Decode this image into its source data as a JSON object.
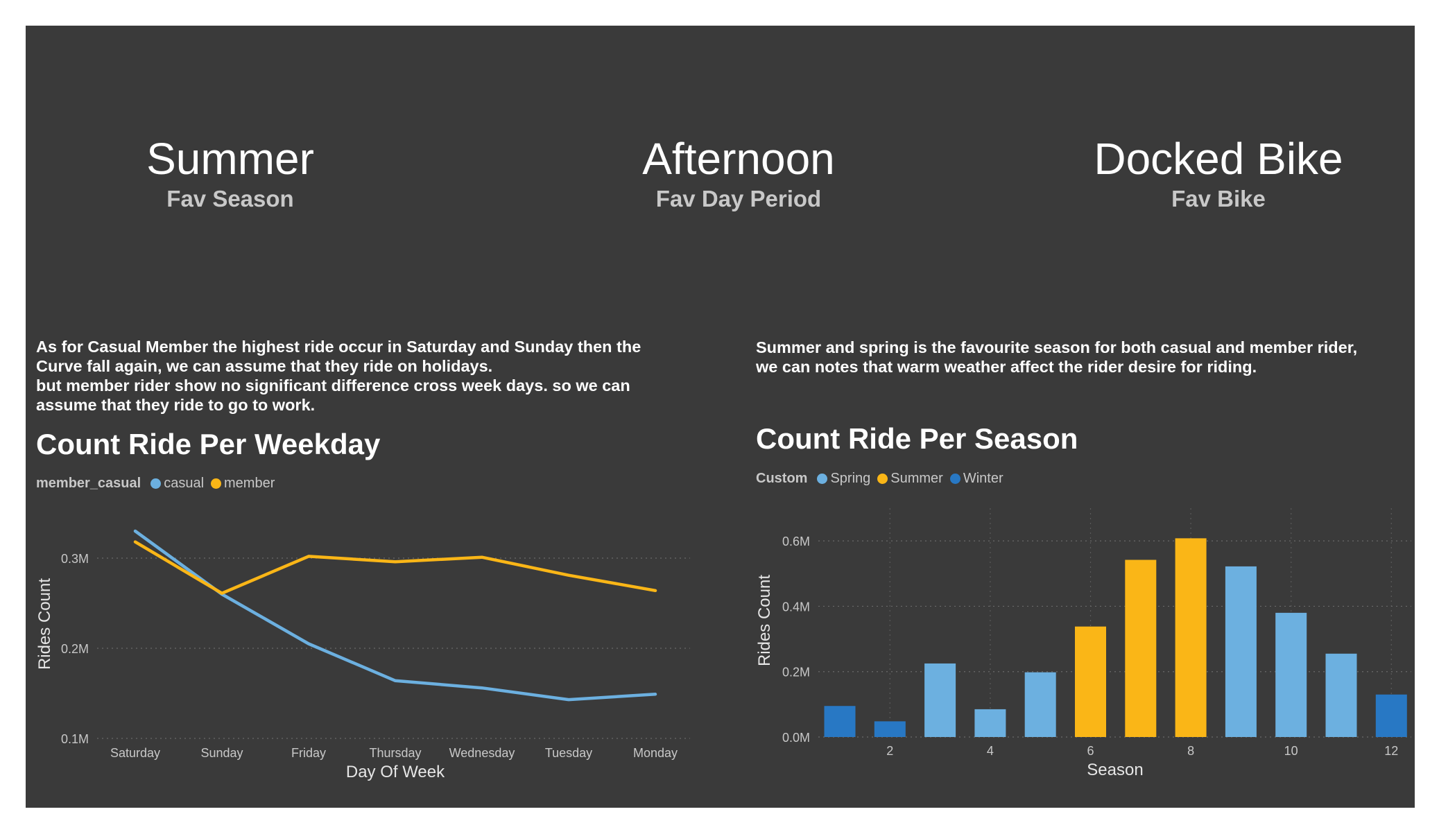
{
  "kpis": [
    {
      "value": "Summer",
      "label": "Fav Season"
    },
    {
      "value": "Afternoon",
      "label": "Fav Day Period"
    },
    {
      "value": "Docked Bike",
      "label": "Fav Bike"
    }
  ],
  "notes": {
    "weekday": [
      "As for Casual Member the highest ride occur in Saturday and Sunday then the",
      "Curve fall again, we can assume that they ride on holidays.",
      "but member rider show no significant difference cross week days. so we can",
      "assume that they ride to go to work."
    ],
    "season": [
      "Summer and spring is the favourite season for both casual and member rider,",
      "we can notes that warm weather affect the rider desire for riding."
    ]
  },
  "colors": {
    "background": "#3a3a3a",
    "casual": "#6cb0e0",
    "member": "#fab617",
    "spring": "#6cb0e0",
    "summer": "#fab617",
    "winter": "#2878c4"
  },
  "chart_data": [
    {
      "type": "line",
      "title": "Count Ride Per Weekday",
      "legend_title": "member_casual",
      "categories": [
        "Saturday",
        "Sunday",
        "Friday",
        "Thursday",
        "Wednesday",
        "Tuesday",
        "Monday"
      ],
      "series": [
        {
          "name": "casual",
          "values": [
            0.33,
            0.26,
            0.205,
            0.164,
            0.156,
            0.143,
            0.149
          ]
        },
        {
          "name": "member",
          "values": [
            0.318,
            0.261,
            0.302,
            0.296,
            0.301,
            0.281,
            0.264
          ]
        }
      ],
      "xlabel": "Day Of Week",
      "ylabel": "Rides Count",
      "yticks": [
        0.1,
        0.2,
        0.3
      ],
      "ytick_labels": [
        "0.1M",
        "0.2M",
        "0.3M"
      ],
      "ylim": [
        0.1,
        0.35
      ],
      "unit": "M",
      "grid": true,
      "legend_position": "top-left"
    },
    {
      "type": "bar",
      "title": "Count Ride Per Season",
      "legend_title": "Custom",
      "legend": [
        "Spring",
        "Summer",
        "Winter"
      ],
      "x": [
        1,
        2,
        3,
        4,
        5,
        6,
        7,
        8,
        9,
        10,
        11,
        12
      ],
      "values": [
        0.095,
        0.048,
        0.225,
        0.085,
        0.198,
        0.338,
        0.542,
        0.608,
        0.522,
        0.38,
        0.255,
        0.13
      ],
      "groups": [
        "Winter",
        "Winter",
        "Spring",
        "Spring",
        "Spring",
        "Summer",
        "Summer",
        "Summer",
        "Spring",
        "Spring",
        "Spring",
        "Winter"
      ],
      "xticks": [
        2,
        4,
        6,
        8,
        10,
        12
      ],
      "xlabel": "Season",
      "ylabel": "Rides Count",
      "yticks": [
        0,
        0.2,
        0.4,
        0.6
      ],
      "ytick_labels": [
        "0.0M",
        "0.2M",
        "0.4M",
        "0.6M"
      ],
      "ylim": [
        0,
        0.7
      ],
      "unit": "M",
      "grid": true,
      "legend_position": "top-left"
    }
  ]
}
